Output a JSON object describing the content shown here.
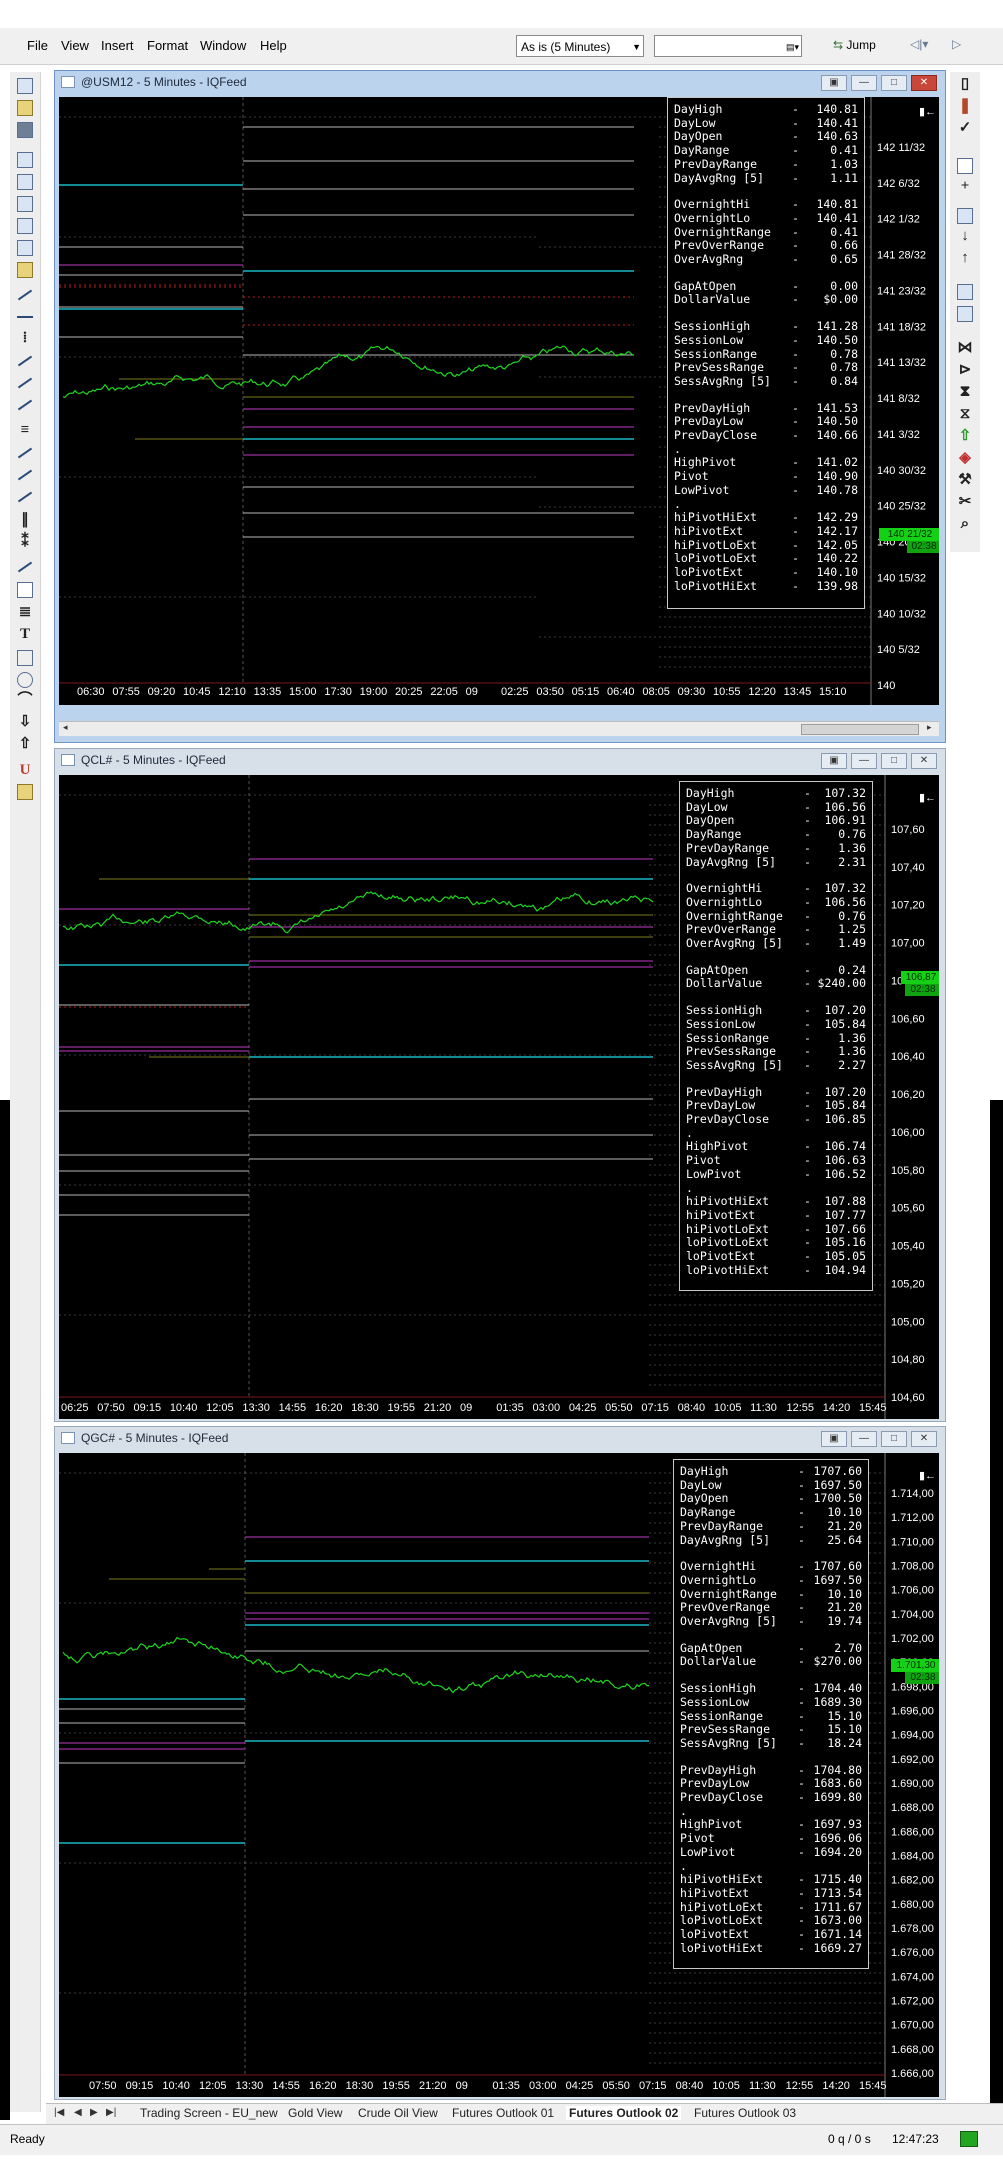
{
  "menu": {
    "items": [
      "File",
      "View",
      "Insert",
      "Format",
      "Window",
      "Help"
    ]
  },
  "toolbar": {
    "interval_value": "As is (5 Minutes)",
    "search_value": "",
    "jump_label": "Jump"
  },
  "charts": [
    {
      "title": "@USM12 - 5 Minutes - IQFeed",
      "price_labels": [
        "142 11/32",
        "142 6/32",
        "142 1/32",
        "141 28/32",
        "141 23/32",
        "141 18/32",
        "141 13/32",
        "141 8/32",
        "141 3/32",
        "140 30/32",
        "140 25/32",
        "140 20/32",
        "140 15/32",
        "140 10/32",
        "140 5/32",
        "140"
      ],
      "time_labels": [
        "06:30",
        "07:55",
        "09:20",
        "10:45",
        "12:10",
        "13:35",
        "15:00",
        "17:30",
        "19:00",
        "20:25",
        "22:05",
        "09",
        "02:25",
        "03:50",
        "05:15",
        "06:40",
        "08:05",
        "09:30",
        "10:55",
        "12:20",
        "13:45",
        "15:10"
      ],
      "badge_top": "140 21/32",
      "badge_bottom": "02:38",
      "stats": [
        {
          "label": "DayHigh",
          "value": "140.81"
        },
        {
          "label": "DayLow",
          "value": "140.41"
        },
        {
          "label": "DayOpen",
          "value": "140.63"
        },
        {
          "label": "DayRange",
          "value": "0.41"
        },
        {
          "label": "PrevDayRange",
          "value": "1.03"
        },
        {
          "label": "DayAvgRng [5]",
          "value": "1.11"
        },
        {
          "gap": true
        },
        {
          "label": "OvernightHi",
          "value": "140.81"
        },
        {
          "label": "OvernightLo",
          "value": "140.41"
        },
        {
          "label": "OvernightRange",
          "value": "0.41"
        },
        {
          "label": "PrevOverRange",
          "value": "0.66"
        },
        {
          "label": "OverAvgRng",
          "value": "0.65"
        },
        {
          "gap": true
        },
        {
          "label": "GapAtOpen",
          "value": "0.00"
        },
        {
          "label": "DollarValue",
          "value": "$0.00"
        },
        {
          "gap": true
        },
        {
          "label": "SessionHigh",
          "value": "141.28"
        },
        {
          "label": "SessionLow",
          "value": "140.50"
        },
        {
          "label": "SessionRange",
          "value": "0.78"
        },
        {
          "label": "PrevSessRange",
          "value": "0.78"
        },
        {
          "label": "SessAvgRng [5]",
          "value": "0.84"
        },
        {
          "gap": true
        },
        {
          "label": "PrevDayHigh",
          "value": "141.53"
        },
        {
          "label": "PrevDayLow",
          "value": "140.50"
        },
        {
          "label": "PrevDayClose",
          "value": "140.66"
        },
        {
          "label": ".",
          "value": ""
        },
        {
          "label": "HighPivot",
          "value": "141.02"
        },
        {
          "label": "Pivot",
          "value": "140.90"
        },
        {
          "label": "LowPivot",
          "value": "140.78"
        },
        {
          "label": ".",
          "value": ""
        },
        {
          "label": "hiPivotHiExt",
          "value": "142.29"
        },
        {
          "label": "hiPivotExt",
          "value": "142.17"
        },
        {
          "label": "hiPivotLoExt",
          "value": "142.05"
        },
        {
          "label": "loPivotLoExt",
          "value": "140.22"
        },
        {
          "label": "loPivotExt",
          "value": "140.10"
        },
        {
          "label": "loPivotHiExt",
          "value": "139.98"
        }
      ]
    },
    {
      "title": "QCL# - 5 Minutes - IQFeed",
      "price_labels": [
        "107,60",
        "107,40",
        "107,20",
        "107,00",
        "106,80",
        "106,60",
        "106,40",
        "106,20",
        "106,00",
        "105,80",
        "105,60",
        "105,40",
        "105,20",
        "105,00",
        "104,80",
        "104,60"
      ],
      "time_labels": [
        "06:25",
        "07:50",
        "09:15",
        "10:40",
        "12:05",
        "13:30",
        "14:55",
        "16:20",
        "18:30",
        "19:55",
        "21:20",
        "09",
        "01:35",
        "03:00",
        "04:25",
        "05:50",
        "07:15",
        "08:40",
        "10:05",
        "11:30",
        "12:55",
        "14:20",
        "15:45"
      ],
      "badge_top": "106,87",
      "badge_bottom": "02:38",
      "stats": [
        {
          "label": "DayHigh",
          "value": "107.32"
        },
        {
          "label": "DayLow",
          "value": "106.56"
        },
        {
          "label": "DayOpen",
          "value": "106.91"
        },
        {
          "label": "DayRange",
          "value": "0.76"
        },
        {
          "label": "PrevDayRange",
          "value": "1.36"
        },
        {
          "label": "DayAvgRng [5]",
          "value": "2.31"
        },
        {
          "gap": true
        },
        {
          "label": "OvernightHi",
          "value": "107.32"
        },
        {
          "label": "OvernightLo",
          "value": "106.56"
        },
        {
          "label": "OvernightRange",
          "value": "0.76"
        },
        {
          "label": "PrevOverRange",
          "value": "1.25"
        },
        {
          "label": "OverAvgRng [5]",
          "value": "1.49"
        },
        {
          "gap": true
        },
        {
          "label": "GapAtOpen",
          "value": "0.24"
        },
        {
          "label": "DollarValue",
          "value": "$240.00"
        },
        {
          "gap": true
        },
        {
          "label": "SessionHigh",
          "value": "107.20"
        },
        {
          "label": "SessionLow",
          "value": "105.84"
        },
        {
          "label": "SessionRange",
          "value": "1.36"
        },
        {
          "label": "PrevSessRange",
          "value": "1.36"
        },
        {
          "label": "SessAvgRng [5]",
          "value": "2.27"
        },
        {
          "gap": true
        },
        {
          "label": "PrevDayHigh",
          "value": "107.20"
        },
        {
          "label": "PrevDayLow",
          "value": "105.84"
        },
        {
          "label": "PrevDayClose",
          "value": "106.85"
        },
        {
          "label": ".",
          "value": ""
        },
        {
          "label": "HighPivot",
          "value": "106.74"
        },
        {
          "label": "Pivot",
          "value": "106.63"
        },
        {
          "label": "LowPivot",
          "value": "106.52"
        },
        {
          "label": ".",
          "value": ""
        },
        {
          "label": "hiPivotHiExt",
          "value": "107.88"
        },
        {
          "label": "hiPivotExt",
          "value": "107.77"
        },
        {
          "label": "hiPivotLoExt",
          "value": "107.66"
        },
        {
          "label": "loPivotLoExt",
          "value": "105.16"
        },
        {
          "label": "loPivotExt",
          "value": "105.05"
        },
        {
          "label": "loPivotHiExt",
          "value": "104.94"
        }
      ]
    },
    {
      "title": "QGC# - 5 Minutes - IQFeed",
      "price_labels": [
        "1.714,00",
        "1.712,00",
        "1.710,00",
        "1.708,00",
        "1.706,00",
        "1.704,00",
        "1.702,00",
        "1.700,00",
        "1.698,00",
        "1.696,00",
        "1.694,00",
        "1.692,00",
        "1.690,00",
        "1.688,00",
        "1.686,00",
        "1.684,00",
        "1.682,00",
        "1.680,00",
        "1.678,00",
        "1.676,00",
        "1.674,00",
        "1.672,00",
        "1.670,00",
        "1.668,00",
        "1.666,00"
      ],
      "time_labels": [
        "07:50",
        "09:15",
        "10:40",
        "12:05",
        "13:30",
        "14:55",
        "16:20",
        "18:30",
        "19:55",
        "21:20",
        "09",
        "01:35",
        "03:00",
        "04:25",
        "05:50",
        "07:15",
        "08:40",
        "10:05",
        "11:30",
        "12:55",
        "14:20",
        "15:45"
      ],
      "badge_top": "1.701,30",
      "badge_bottom": "02:38",
      "stats": [
        {
          "label": "DayHigh",
          "value": "1707.60"
        },
        {
          "label": "DayLow",
          "value": "1697.50"
        },
        {
          "label": "DayOpen",
          "value": "1700.50"
        },
        {
          "label": "DayRange",
          "value": "10.10"
        },
        {
          "label": "PrevDayRange",
          "value": "21.20"
        },
        {
          "label": "DayAvgRng [5]",
          "value": "25.64"
        },
        {
          "gap": true
        },
        {
          "label": "OvernightHi",
          "value": "1707.60"
        },
        {
          "label": "OvernightLo",
          "value": "1697.50"
        },
        {
          "label": "OvernightRange",
          "value": "10.10"
        },
        {
          "label": "PrevOverRange",
          "value": "21.20"
        },
        {
          "label": "OverAvgRng [5]",
          "value": "19.74"
        },
        {
          "gap": true
        },
        {
          "label": "GapAtOpen",
          "value": "2.70"
        },
        {
          "label": "DollarValue",
          "value": "$270.00"
        },
        {
          "gap": true
        },
        {
          "label": "SessionHigh",
          "value": "1704.40"
        },
        {
          "label": "SessionLow",
          "value": "1689.30"
        },
        {
          "label": "SessionRange",
          "value": "15.10"
        },
        {
          "label": "PrevSessRange",
          "value": "15.10"
        },
        {
          "label": "SessAvgRng [5]",
          "value": "18.24"
        },
        {
          "gap": true
        },
        {
          "label": "PrevDayHigh",
          "value": "1704.80"
        },
        {
          "label": "PrevDayLow",
          "value": "1683.60"
        },
        {
          "label": "PrevDayClose",
          "value": "1699.80"
        },
        {
          "label": ".",
          "value": ""
        },
        {
          "label": "HighPivot",
          "value": "1697.93"
        },
        {
          "label": "Pivot",
          "value": "1696.06"
        },
        {
          "label": "LowPivot",
          "value": "1694.20"
        },
        {
          "label": ".",
          "value": ""
        },
        {
          "label": "hiPivotHiExt",
          "value": "1715.40"
        },
        {
          "label": "hiPivotExt",
          "value": "1713.54"
        },
        {
          "label": "hiPivotLoExt",
          "value": "1711.67"
        },
        {
          "label": "loPivotLoExt",
          "value": "1673.00"
        },
        {
          "label": "loPivotExt",
          "value": "1671.14"
        },
        {
          "label": "loPivotHiExt",
          "value": "1669.27"
        }
      ]
    }
  ],
  "sheets": {
    "tabs": [
      "Trading Screen - EU_new",
      "Gold View",
      "Crude Oil View",
      "Futures Outlook 01",
      "Futures Outlook 02",
      "Futures Outlook 03"
    ],
    "active": "Futures Outlook 02"
  },
  "status": {
    "text": "Ready",
    "queue": "0 q / 0 s",
    "time": "12:47:23"
  },
  "colors": {
    "price": "#1fd51f",
    "cyan_level": "#19b7c8",
    "magenta_level": "#c23ac2",
    "olive_level": "#7a7a1a",
    "grey_level": "#b8b8b8",
    "red_dotted": "#b51e1e",
    "badge": "#15d115"
  }
}
